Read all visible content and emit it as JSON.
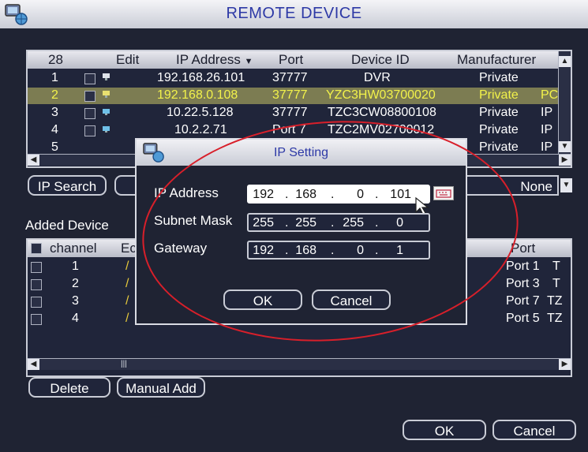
{
  "window": {
    "title": "REMOTE DEVICE"
  },
  "search_table": {
    "headers": {
      "count": "28",
      "edit": "Edit",
      "ip": "IP Address",
      "port": "Port",
      "device_id": "Device ID",
      "manufacturer": "Manufacturer"
    },
    "rows": [
      {
        "num": "1",
        "ip": "192.168.26.101",
        "port": "37777",
        "device_id": "DVR",
        "manufacturer": "Private",
        "extra": ""
      },
      {
        "num": "2",
        "ip": "192.168.0.108",
        "port": "37777",
        "device_id": "YZC3HW03700020",
        "manufacturer": "Private",
        "extra": "PC"
      },
      {
        "num": "3",
        "ip": "10.22.5.128",
        "port": "37777",
        "device_id": "TZC3CW08800108",
        "manufacturer": "Private",
        "extra": "IP"
      },
      {
        "num": "4",
        "ip": "10.2.2.71",
        "port": "Port 7",
        "device_id": "TZC2MV02700012",
        "manufacturer": "Private",
        "extra": "IP"
      },
      {
        "num": "5",
        "ip": "",
        "port": "",
        "device_id": "",
        "manufacturer": "Private",
        "extra": "IP"
      }
    ]
  },
  "controls": {
    "ip_search": "IP Search",
    "filter_value": "None"
  },
  "added": {
    "title": "Added Device",
    "headers": {
      "channel": "channel",
      "edit": "Ec",
      "port": "Port",
      "extra": ""
    },
    "rows": [
      {
        "channel": "1",
        "port": "Port 1",
        "extra": "T"
      },
      {
        "channel": "2",
        "port": "Port 3",
        "extra": "T"
      },
      {
        "channel": "3",
        "port": "Port 7",
        "extra": "TZ"
      },
      {
        "channel": "4",
        "port": "Port 5",
        "extra": "TZ"
      }
    ]
  },
  "buttons": {
    "delete": "Delete",
    "manual_add": "Manual Add",
    "ok": "OK",
    "cancel": "Cancel"
  },
  "ip_dialog": {
    "title": "IP Setting",
    "ip_label": "IP Address",
    "ip": [
      "192",
      "168",
      "0",
      "101"
    ],
    "mask_label": "Subnet Mask",
    "mask": [
      "255",
      "255",
      "255",
      "0"
    ],
    "gateway_label": "Gateway",
    "gateway": [
      "192",
      "168",
      "0",
      "1"
    ],
    "ok": "OK",
    "cancel": "Cancel"
  },
  "colors": {
    "title_text": "#2d39a6",
    "selected_row_bg": "#7c7c52",
    "selected_row_text": "#f2f24a",
    "annotation_ring": "#d81f2a"
  }
}
